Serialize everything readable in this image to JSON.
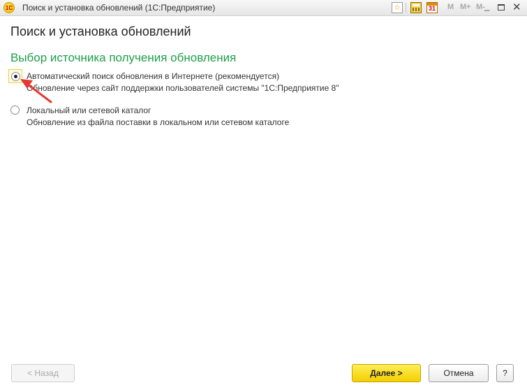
{
  "window": {
    "title": "Поиск и установка обновлений  (1С:Предприятие)",
    "logo_text": "1С",
    "toolbar": {
      "favorite_icon": "☆",
      "calendar_day": "31",
      "mem_m": "M",
      "mem_mplus": "M+",
      "mem_mminus": "M-",
      "minimize_glyph": "_",
      "close_glyph": "✕"
    }
  },
  "page": {
    "title": "Поиск и установка обновлений",
    "section_title": "Выбор источника получения обновления"
  },
  "options": [
    {
      "label": "Автоматический поиск обновления в Интернете (рекомендуется)",
      "description": "Обновление через сайт поддержки пользователей системы \"1С:Предприятие 8\"",
      "selected": true
    },
    {
      "label": "Локальный или сетевой каталог",
      "description": "Обновление из файла поставки в локальном или сетевом каталоге",
      "selected": false
    }
  ],
  "footer": {
    "back_label": "< Назад",
    "next_label": "Далее >",
    "cancel_label": "Отмена",
    "help_label": "?"
  },
  "colors": {
    "section_title": "#1e9e4a",
    "annotation_arrow": "#e53935",
    "primary_button": "#f3cf00"
  }
}
